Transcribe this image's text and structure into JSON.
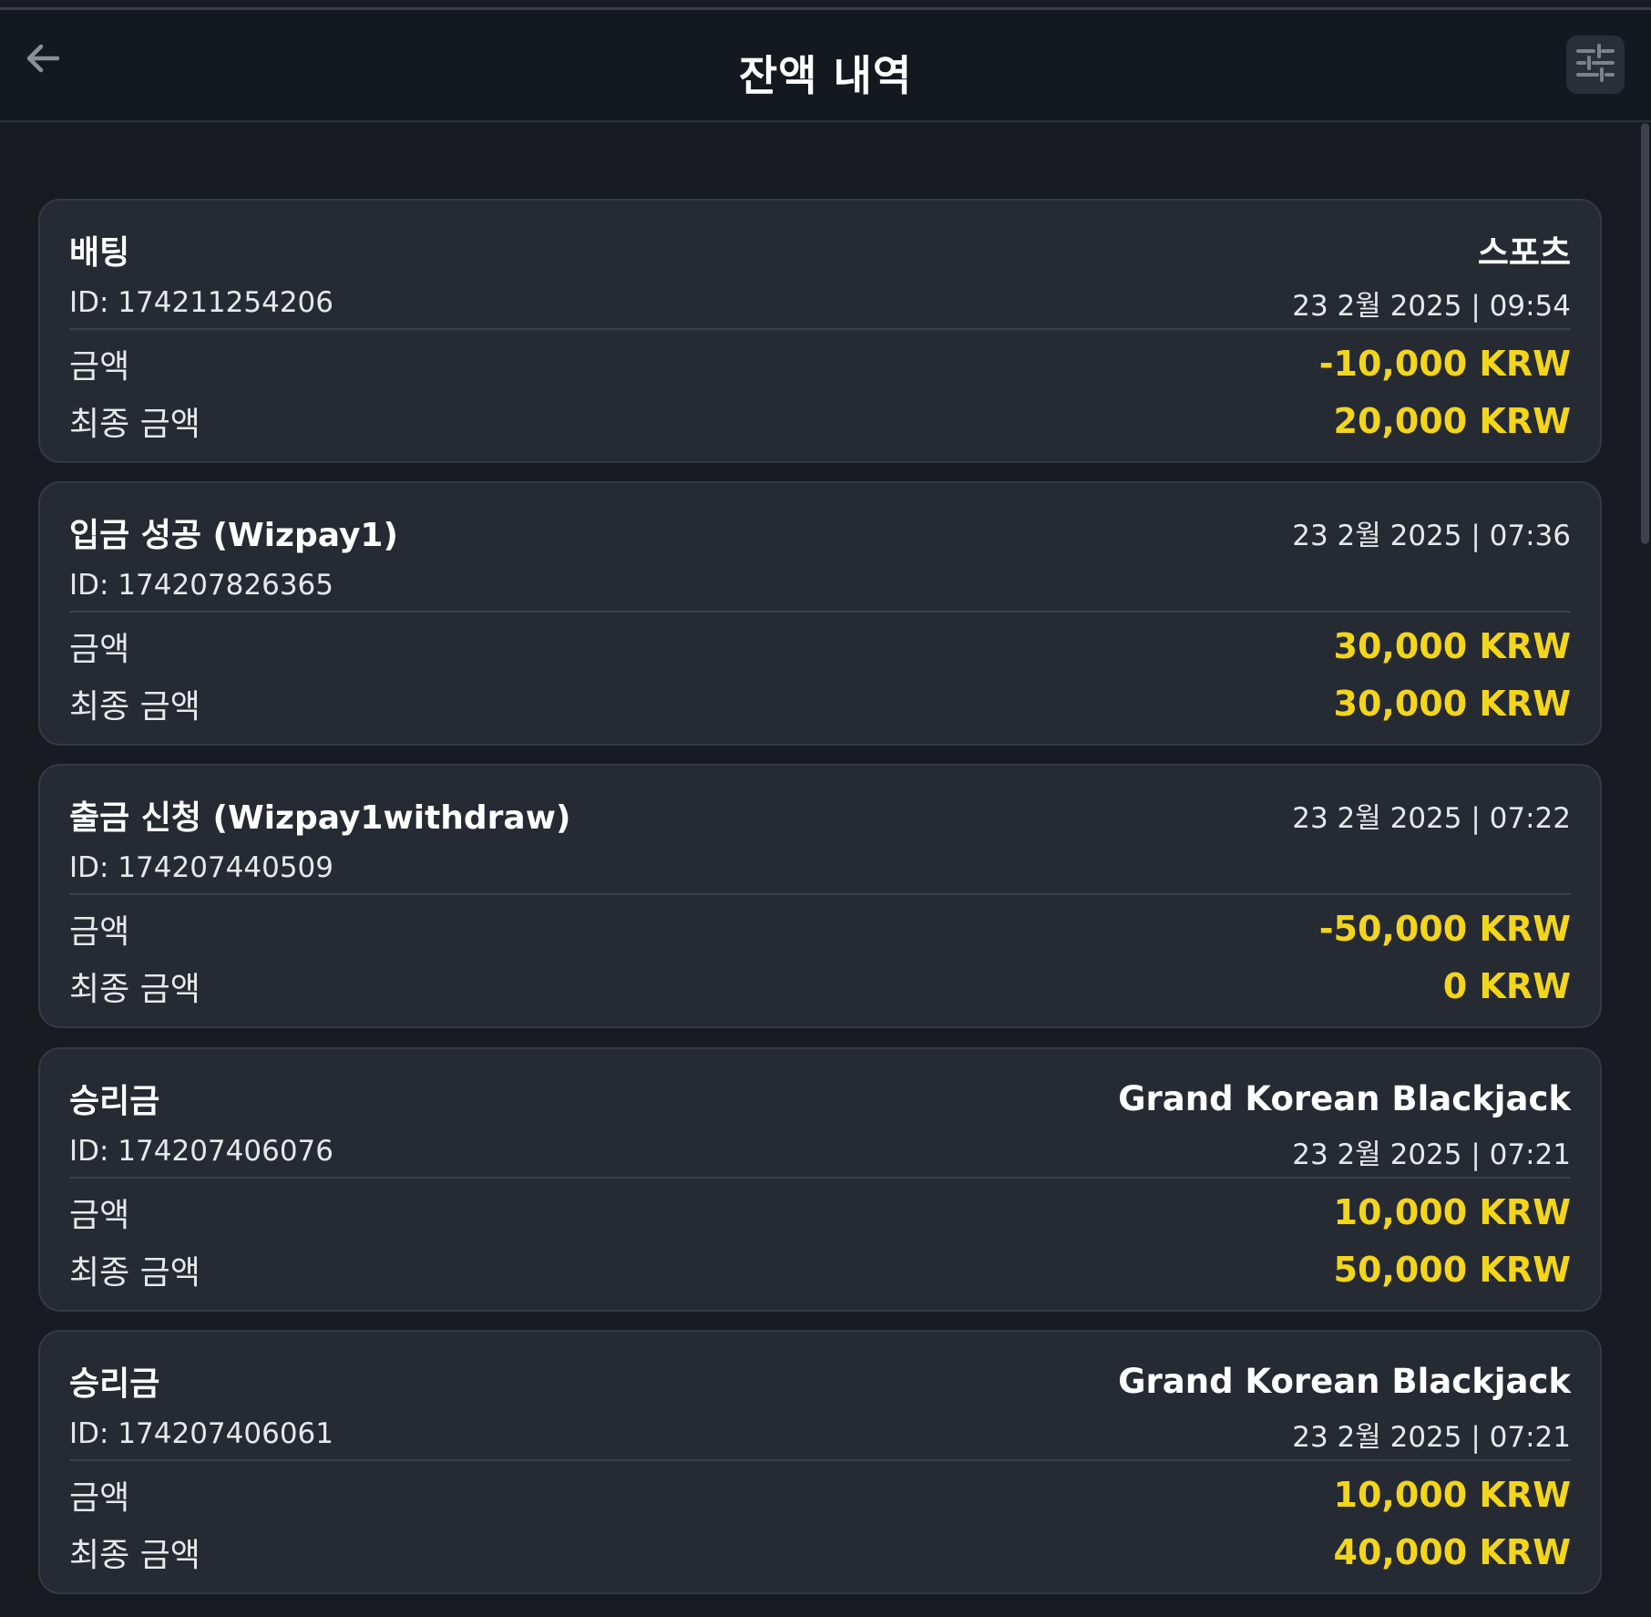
{
  "header": {
    "title": "잔액 내역"
  },
  "colors": {
    "accent": "#f3d51a",
    "background": "#181c22",
    "card": "#252a33"
  },
  "transactions": [
    {
      "type": "배팅",
      "provider": "스포츠",
      "id": "ID: 174211254206",
      "date": "23 2월 2025 | 09:54",
      "amount_label": "금액",
      "amount": "-10,000 KRW",
      "final_label": "최종 금액",
      "final_amount": "20,000 KRW"
    },
    {
      "type": "입금 성공 (Wizpay1)",
      "provider": "",
      "id": "ID: 174207826365",
      "date": "23 2월 2025 | 07:36",
      "amount_label": "금액",
      "amount": "30,000 KRW",
      "final_label": "최종 금액",
      "final_amount": "30,000 KRW"
    },
    {
      "type": "출금 신청 (Wizpay1withdraw)",
      "provider": "",
      "id": "ID: 174207440509",
      "date": "23 2월 2025 | 07:22",
      "amount_label": "금액",
      "amount": "-50,000 KRW",
      "final_label": "최종 금액",
      "final_amount": "0 KRW"
    },
    {
      "type": "승리금",
      "provider": "Grand Korean Blackjack",
      "id": "ID: 174207406076",
      "date": "23 2월 2025 | 07:21",
      "amount_label": "금액",
      "amount": "10,000 KRW",
      "final_label": "최종 금액",
      "final_amount": "50,000 KRW"
    },
    {
      "type": "승리금",
      "provider": "Grand Korean Blackjack",
      "id": "ID: 174207406061",
      "date": "23 2월 2025 | 07:21",
      "amount_label": "금액",
      "amount": "10,000 KRW",
      "final_label": "최종 금액",
      "final_amount": "40,000 KRW"
    }
  ]
}
